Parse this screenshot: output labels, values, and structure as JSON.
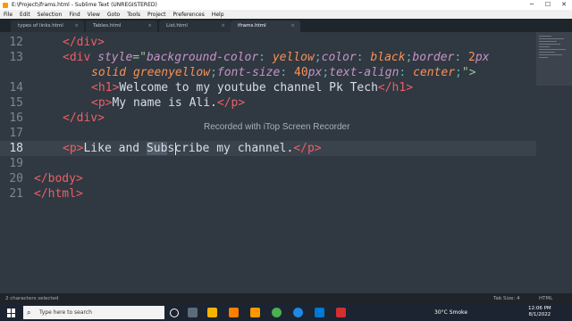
{
  "window": {
    "title": "E:\\Project\\iframs.html - Sublime Text (UNREGISTERED)"
  },
  "window_controls": {
    "minimize": "─",
    "maximize": "☐",
    "close": "✕"
  },
  "menu": [
    "File",
    "Edit",
    "Selection",
    "Find",
    "View",
    "Goto",
    "Tools",
    "Project",
    "Preferences",
    "Help"
  ],
  "tabs": [
    {
      "label": "types of links.html",
      "close": "×"
    },
    {
      "label": "Tables.html",
      "close": "×"
    },
    {
      "label": "List.html",
      "close": "×"
    },
    {
      "label": "iframs.html",
      "close": "×"
    }
  ],
  "code": {
    "ghost_top": "'",
    "lines": [
      {
        "n": "12"
      },
      {
        "n": "13"
      },
      {
        "n": ""
      },
      {
        "n": "14"
      },
      {
        "n": "15"
      },
      {
        "n": "16"
      },
      {
        "n": "17"
      },
      {
        "n": "18"
      },
      {
        "n": "19"
      },
      {
        "n": "20"
      },
      {
        "n": "21"
      }
    ],
    "l12": "</div>",
    "l13_open": "<div",
    "l13_attr": "style",
    "l13_eq": "=\"",
    "l13_p1": "background-color",
    "l13_v1": "yellow",
    "l13_p2": "color",
    "l13_v2": "black",
    "l13_p3": "border",
    "l13_v3num": "2",
    "l13_v3unit": "px",
    "l13b_v3rest": "solid greenyellow",
    "l13b_p4": "font-size",
    "l13b_v4num": "40",
    "l13b_v4unit": "px",
    "l13b_p5": "text-align",
    "l13b_v5": "center",
    "l13b_close": "\">",
    "l14_open": "<h1>",
    "l14_text": "Welcome to my youtube channel Pk Tech",
    "l14_close": "</h1>",
    "l15_open": "<p>",
    "l15_text": "My name is Ali.",
    "l15_close": "</p>",
    "l16": "</div>",
    "l18_open": "<p>",
    "l18_text_a": "Like and ",
    "l18_sel": "Sub",
    "l18_text_b": "scribe my channel.",
    "l18_close": "</p>",
    "l20": "</body>",
    "l21": "</html>"
  },
  "watermark": "Recorded with iTop Screen Recorder",
  "status": {
    "left": "2 characters selected",
    "tab_size": "Tab Size: 4",
    "syntax": "HTML"
  },
  "taskbar": {
    "search_placeholder": "Type here to search",
    "weather": "30°C  Smoke",
    "time": "12:06 PM",
    "date": "8/1/2022"
  },
  "colors": {
    "editor_bg": "#303841",
    "tag": "#ec5f67",
    "string": "#99c794",
    "property": "#c594c5",
    "value": "#f99157"
  }
}
